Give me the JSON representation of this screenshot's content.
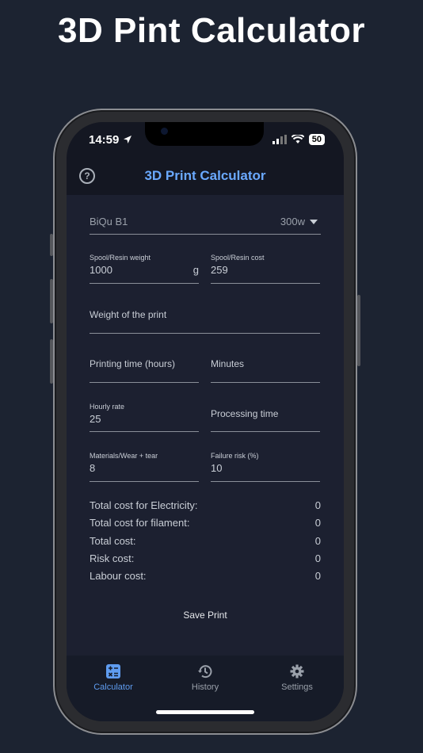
{
  "headline": "3D Pint Calculator",
  "status": {
    "time": "14:59",
    "battery": "50"
  },
  "app": {
    "title": "3D Print Calculator"
  },
  "printer": {
    "name": "BiQu B1",
    "power": "300w"
  },
  "fields": {
    "spool_weight": {
      "label": "Spool/Resin weight",
      "value": "1000",
      "suffix": "g"
    },
    "spool_cost": {
      "label": "Spool/Resin cost",
      "value": "259"
    },
    "print_weight": {
      "placeholder": "Weight of the print"
    },
    "print_hours": {
      "placeholder": "Printing time (hours)"
    },
    "print_minutes": {
      "placeholder": "Minutes"
    },
    "hourly_rate": {
      "label": "Hourly rate",
      "value": "25"
    },
    "processing_time": {
      "placeholder": "Processing time"
    },
    "materials_wear": {
      "label": "Materials/Wear + tear",
      "value": "8"
    },
    "failure_risk": {
      "label": "Failure risk (%)",
      "value": "10"
    }
  },
  "summary": [
    {
      "label": "Total cost for Electricity:",
      "value": "0"
    },
    {
      "label": "Total cost for filament:",
      "value": "0"
    },
    {
      "label": "Total cost:",
      "value": "0"
    },
    {
      "label": "Risk cost:",
      "value": "0"
    },
    {
      "label": "Labour cost:",
      "value": "0"
    }
  ],
  "actions": {
    "save": "Save Print"
  },
  "tabs": [
    {
      "label": "Calculator",
      "icon": "calculator-icon",
      "active": true
    },
    {
      "label": "History",
      "icon": "history-icon",
      "active": false
    },
    {
      "label": "Settings",
      "icon": "gear-icon",
      "active": false
    }
  ],
  "colors": {
    "accent": "#5f9cf0",
    "background": "#1c2331",
    "screen": "#1c2030"
  }
}
